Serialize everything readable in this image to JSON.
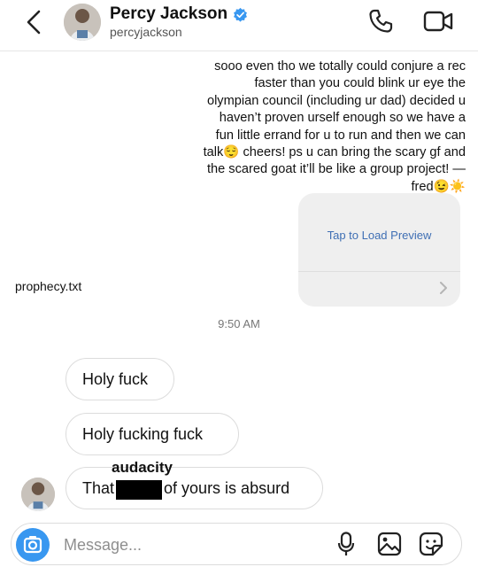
{
  "header": {
    "name": "Percy Jackson",
    "handle": "percyjackson",
    "back_icon": "chevron-left-icon",
    "verified_icon": "verified-badge-icon",
    "call_icon": "phone-icon",
    "video_icon": "video-camera-icon"
  },
  "outgoing_message": {
    "text": "sooo even tho we totally could conjure a rec faster than you could blink ur eye the olympian council (including ur dad) decided u haven’t proven urself enough so we have a fun little errand for u to run and then we can talk😌 cheers! ps u can bring the scary gf and the scared goat it’ll be like a group project! —fred😉☀️"
  },
  "attachment": {
    "preview_label": "Tap to Load Preview",
    "file_name": "prophecy.txt"
  },
  "timestamp": "9:50 AM",
  "incoming_messages": [
    {
      "text": "Holy fuck"
    },
    {
      "text": "Holy fucking fuck"
    },
    {
      "before": "That",
      "after": "of yours is absurd"
    }
  ],
  "overlay_word": "audacity",
  "composer": {
    "placeholder": "Message...",
    "camera_icon": "camera-icon",
    "mic_icon": "microphone-icon",
    "gallery_icon": "gallery-icon",
    "sticker_icon": "sticker-icon"
  },
  "colors": {
    "accent": "#3897f0",
    "verified": "#3897f0",
    "link": "#3f6fb4",
    "redaction": "#000000"
  }
}
